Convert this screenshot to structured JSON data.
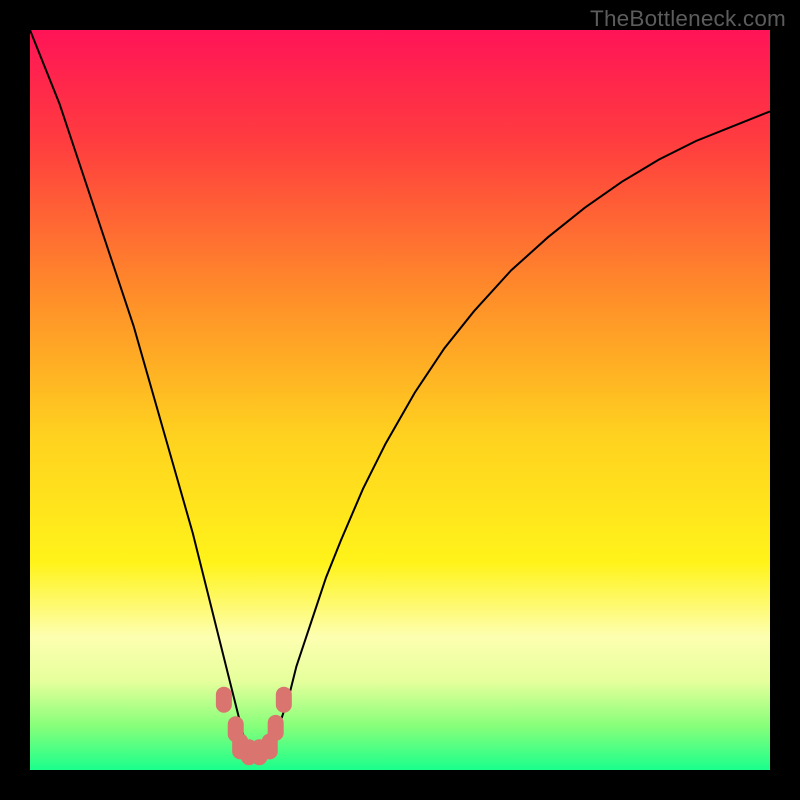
{
  "watermark": "TheBottleneck.com",
  "chart_data": {
    "type": "line",
    "title": "",
    "xlabel": "",
    "ylabel": "",
    "xlim": [
      0,
      100
    ],
    "ylim": [
      0,
      100
    ],
    "plot_background": {
      "type": "vertical-gradient",
      "stops": [
        {
          "offset": 0.0,
          "color": "#ff1457"
        },
        {
          "offset": 0.15,
          "color": "#ff3c3f"
        },
        {
          "offset": 0.35,
          "color": "#ff8a2a"
        },
        {
          "offset": 0.55,
          "color": "#ffd21f"
        },
        {
          "offset": 0.72,
          "color": "#fff31a"
        },
        {
          "offset": 0.82,
          "color": "#fdffb0"
        },
        {
          "offset": 0.88,
          "color": "#e6ff9c"
        },
        {
          "offset": 0.94,
          "color": "#88ff7a"
        },
        {
          "offset": 1.0,
          "color": "#1aff8c"
        }
      ]
    },
    "series": [
      {
        "name": "bottleneck-curve",
        "color": "#000000",
        "stroke_width": 2,
        "x": [
          0,
          2,
          4,
          6,
          8,
          10,
          12,
          14,
          16,
          18,
          20,
          22,
          24,
          26,
          27,
          28,
          29,
          29.5,
          30,
          31,
          32,
          33,
          34,
          35,
          36,
          38,
          40,
          42,
          45,
          48,
          52,
          56,
          60,
          65,
          70,
          75,
          80,
          85,
          90,
          95,
          100
        ],
        "values": [
          100,
          95,
          90,
          84,
          78,
          72,
          66,
          60,
          53,
          46,
          39,
          32,
          24,
          16,
          12,
          8,
          4,
          2.5,
          2,
          2,
          2.5,
          4,
          7,
          10,
          14,
          20,
          26,
          31,
          38,
          44,
          51,
          57,
          62,
          67.5,
          72,
          76,
          79.5,
          82.5,
          85,
          87,
          89
        ]
      }
    ],
    "markers": [
      {
        "name": "trough-markers",
        "color": "#d9746e",
        "radius": 10,
        "shape": "rounded-pill",
        "points": [
          {
            "x": 26.2,
            "y": 9.5
          },
          {
            "x": 27.8,
            "y": 5.5
          },
          {
            "x": 28.4,
            "y": 3.2
          },
          {
            "x": 29.6,
            "y": 2.4
          },
          {
            "x": 31.0,
            "y": 2.4
          },
          {
            "x": 32.4,
            "y": 3.2
          },
          {
            "x": 33.2,
            "y": 5.7
          },
          {
            "x": 34.3,
            "y": 9.5
          }
        ]
      }
    ]
  }
}
